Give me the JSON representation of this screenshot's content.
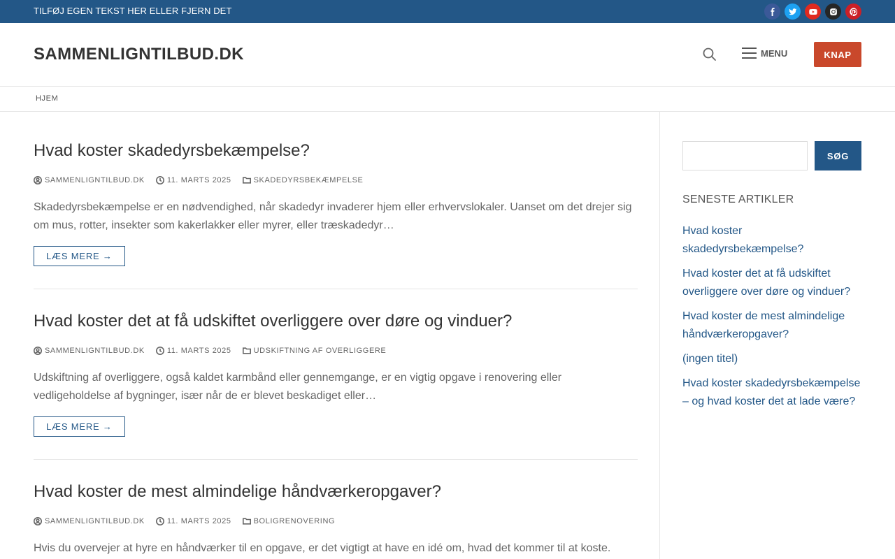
{
  "topbar": {
    "text": "TILFØJ EGEN TEKST HER ELLER FJERN DET",
    "socials": [
      {
        "icon": "facebook-icon",
        "color": "#3b5998"
      },
      {
        "icon": "twitter-icon",
        "color": "#1da1f2"
      },
      {
        "icon": "youtube-icon",
        "color": "#e02a20"
      },
      {
        "icon": "instagram-icon",
        "color": "#262626"
      },
      {
        "icon": "pinterest-icon",
        "color": "#cb2027"
      }
    ]
  },
  "header": {
    "site_title": "SAMMENLIGNTILBUD.DK",
    "menu_label": "MENU",
    "button_label": "KNAP",
    "button_color": "#c9482b"
  },
  "nav": {
    "items": [
      "HJEM"
    ]
  },
  "articles": [
    {
      "title": "Hvad koster skadedyrsbekæmpelse?",
      "author": "SAMMENLIGNTILBUD.DK",
      "date": "11. MARTS 2025",
      "category": "SKADEDYRSBEKÆMPELSE",
      "excerpt": "Skadedyrsbekæmpelse er en nødvendighed, når skadedyr invaderer hjem eller erhvervslokaler. Uanset om det drejer sig om mus, rotter, insekter som kakerlakker eller myrer, eller træskadedyr…",
      "read_more": "LÆS MERE →"
    },
    {
      "title": "Hvad koster det at få udskiftet overliggere over døre og vinduer?",
      "author": "SAMMENLIGNTILBUD.DK",
      "date": "11. MARTS 2025",
      "category": "UDSKIFTNING AF OVERLIGGERE",
      "excerpt": "Udskiftning af overliggere, også kaldet karmbånd eller gennemgange, er en vigtig opgave i renovering eller vedligeholdelse af bygninger, især når de er blevet beskadiget eller…",
      "read_more": "LÆS MERE →"
    },
    {
      "title": "Hvad koster de mest almindelige håndværkeropgaver?",
      "author": "SAMMENLIGNTILBUD.DK",
      "date": "11. MARTS 2025",
      "category": "BOLIGRENOVERING",
      "excerpt": "Hvis du overvejer at hyre en håndværker til en opgave, er det vigtigt at have en idé om, hvad det kommer til at koste."
    }
  ],
  "sidebar": {
    "search_button": "SØG",
    "search_value": "",
    "widget_title": "SENESTE ARTIKLER",
    "recent": [
      "Hvad koster skadedyrsbekæmpelse?",
      "Hvad koster det at få udskiftet overliggere over døre og vinduer?",
      "Hvad koster de mest almindelige håndværkeropgaver?",
      "(ingen titel)",
      "Hvad koster skadedyrsbekæmpelse – og hvad koster det at lade være?"
    ]
  },
  "colors": {
    "primary": "#235787",
    "accent": "#c9482b"
  }
}
